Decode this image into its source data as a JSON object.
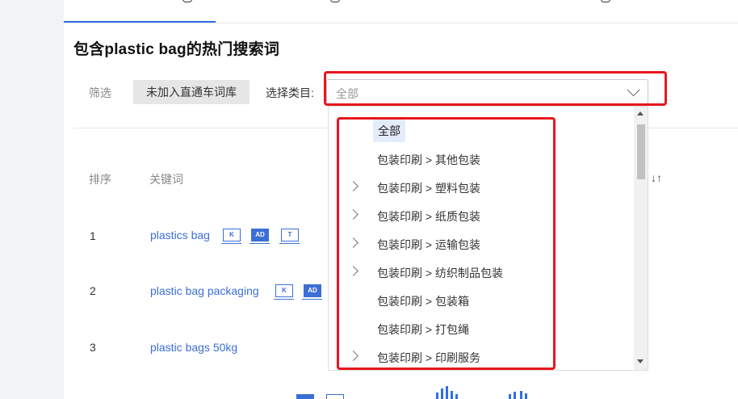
{
  "section": {
    "title": "包含plastic bag的热门搜索词"
  },
  "filters": {
    "label": "筛选",
    "tag_label": "未加入直通车词库",
    "category_label": "选择类目:",
    "category_value": "全部"
  },
  "dropdown": {
    "items": [
      {
        "label": "全部",
        "selected": true,
        "expandable": false
      },
      {
        "label": "包装印刷 > 其他包装",
        "selected": false,
        "expandable": false
      },
      {
        "label": "包装印刷 > 塑料包装",
        "selected": false,
        "expandable": true
      },
      {
        "label": "包装印刷 > 纸质包装",
        "selected": false,
        "expandable": true
      },
      {
        "label": "包装印刷 > 运输包装",
        "selected": false,
        "expandable": true
      },
      {
        "label": "包装印刷 > 纺织制品包装",
        "selected": false,
        "expandable": true
      },
      {
        "label": "包装印刷 > 包装箱",
        "selected": false,
        "expandable": false
      },
      {
        "label": "包装印刷 > 打包绳",
        "selected": false,
        "expandable": false
      },
      {
        "label": "包装印刷 > 印刷服务",
        "selected": false,
        "expandable": true
      }
    ]
  },
  "table": {
    "headers": {
      "rank": "排序",
      "keyword": "关键词",
      "sort": "↓↑"
    },
    "rows": [
      {
        "rank": "1",
        "keyword": "plastics bag",
        "badges": [
          "K",
          "AD",
          "T"
        ]
      },
      {
        "rank": "2",
        "keyword": "plastic bag packaging",
        "badges": [
          "K",
          "AD"
        ]
      },
      {
        "rank": "3",
        "keyword": "plastic bags 50kg",
        "badges": []
      }
    ]
  },
  "colors": {
    "accent": "#2f6fe4",
    "link": "#3b6fd4",
    "highlight": "#e8161c"
  }
}
